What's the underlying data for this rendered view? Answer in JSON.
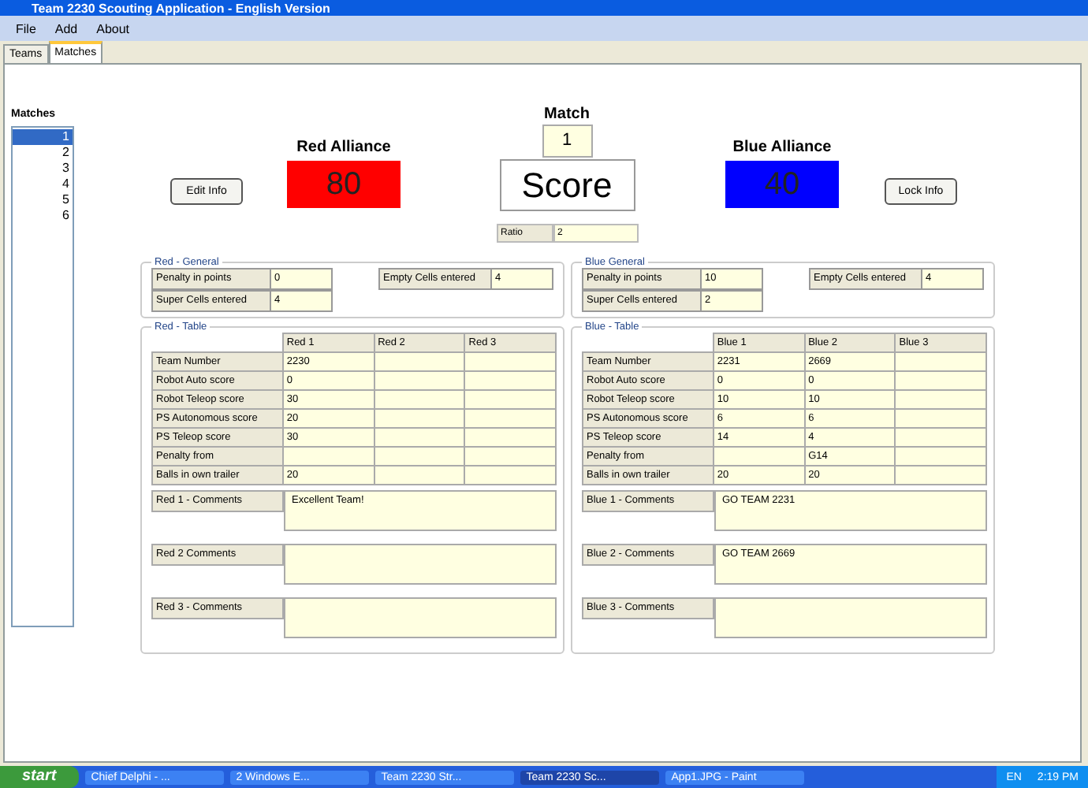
{
  "window": {
    "title": "Team 2230 Scouting Application - English Version"
  },
  "menu": [
    "File",
    "Add",
    "About"
  ],
  "tabs": [
    {
      "label": "Teams",
      "selected": false
    },
    {
      "label": "Matches",
      "selected": true
    }
  ],
  "matches": {
    "heading": "Matches",
    "items": [
      {
        "label": "1",
        "selected": true
      },
      {
        "label": "2",
        "selected": false
      },
      {
        "label": "3",
        "selected": false
      },
      {
        "label": "4",
        "selected": false
      },
      {
        "label": "5",
        "selected": false
      },
      {
        "label": "6",
        "selected": false
      }
    ]
  },
  "header": {
    "edit_button": "Edit Info",
    "lock_button": "Lock Info",
    "match_label": "Match",
    "match_value": "1",
    "score_label": "Score",
    "ratio_label": "Ratio",
    "ratio_value": "2"
  },
  "alliances": [
    {
      "title": "Red Alliance",
      "score": "80",
      "color": "#ff0000",
      "general_title": "Red - General",
      "general": [
        {
          "label": "Penalty in points",
          "value": "0"
        },
        {
          "label": "Super Cells entered",
          "value": "4"
        },
        {
          "label": "Empty Cells entered",
          "value": "4"
        }
      ],
      "table_title": "Red - Table",
      "columns": [
        "Red 1",
        "Red 2",
        "Red 3"
      ],
      "rows": [
        {
          "label": "Team Number",
          "cells": [
            "2230",
            "",
            ""
          ]
        },
        {
          "label": "Robot Auto score",
          "cells": [
            "0",
            "",
            ""
          ]
        },
        {
          "label": "Robot Teleop score",
          "cells": [
            "30",
            "",
            ""
          ]
        },
        {
          "label": "PS Autonomous score",
          "cells": [
            "20",
            "",
            ""
          ]
        },
        {
          "label": "PS Teleop score",
          "cells": [
            "30",
            "",
            ""
          ]
        },
        {
          "label": "Penalty from",
          "cells": [
            "",
            "",
            ""
          ]
        },
        {
          "label": "Balls in own trailer",
          "cells": [
            "20",
            "",
            ""
          ]
        }
      ],
      "comments": [
        {
          "label": "Red 1 - Comments",
          "value": "Excellent Team!"
        },
        {
          "label": "Red 2  Comments"
        },
        {
          "label": "Red 3 - Comments"
        }
      ]
    },
    {
      "title": "Blue Alliance",
      "score": "40",
      "color": "#0000ff",
      "general_title": "Blue General",
      "general": [
        {
          "label": "Penalty in points",
          "value": "10"
        },
        {
          "label": "Super Cells entered",
          "value": "2"
        },
        {
          "label": "Empty Cells entered",
          "value": "4"
        }
      ],
      "table_title": "Blue - Table",
      "columns": [
        "Blue 1",
        "Blue 2",
        "Blue 3"
      ],
      "rows": [
        {
          "label": "Team Number",
          "cells": [
            "2231",
            "2669",
            ""
          ]
        },
        {
          "label": "Robot Auto score",
          "cells": [
            "0",
            "0",
            ""
          ]
        },
        {
          "label": "Robot Teleop score",
          "cells": [
            "10",
            "10",
            ""
          ]
        },
        {
          "label": "PS Autonomous score",
          "cells": [
            "6",
            "6",
            ""
          ]
        },
        {
          "label": "PS Teleop score",
          "cells": [
            "14",
            "4",
            ""
          ]
        },
        {
          "label": "Penalty from",
          "cells": [
            "",
            "G14",
            ""
          ]
        },
        {
          "label": "Balls in own trailer",
          "cells": [
            "20",
            "20",
            ""
          ]
        }
      ],
      "comments": [
        {
          "label": "Blue 1 - Comments",
          "value": "GO TEAM 2231"
        },
        {
          "label": "Blue 2 - Comments",
          "value": "GO TEAM 2669"
        },
        {
          "label": "Blue 3 - Comments"
        }
      ]
    }
  ],
  "taskbar": {
    "start": "start",
    "items": [
      {
        "label": "Chief Delphi - ...",
        "selected": false
      },
      {
        "label": "2 Windows E...",
        "selected": false
      },
      {
        "label": "Team 2230 Str...",
        "selected": false
      },
      {
        "label": "Team 2230 Sc...",
        "selected": true
      },
      {
        "label": "App1.JPG - Paint",
        "selected": false
      }
    ],
    "language": "EN",
    "clock": "2:19 PM"
  }
}
